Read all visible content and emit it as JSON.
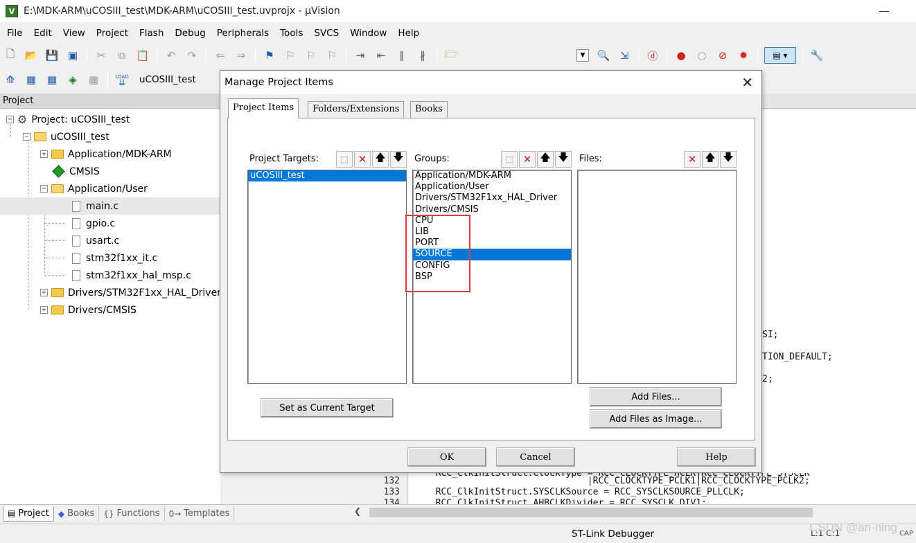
{
  "window": {
    "title": "E:\\MDK-ARM\\uCOSIII_test\\MDK-ARM\\uCOSIII_test.uvprojx - µVision",
    "icon_label": "V",
    "minimize": "—"
  },
  "menu": [
    "File",
    "Edit",
    "View",
    "Project",
    "Flash",
    "Debug",
    "Peripherals",
    "Tools",
    "SVCS",
    "Window",
    "Help"
  ],
  "toolbar": {
    "target_name": "uCOSIII_test",
    "load_label": "LOAD"
  },
  "project_panel": {
    "header": "Project",
    "root": "Project: uCOSIII_test",
    "target": "uCOSIII_test",
    "groups": [
      {
        "name": "Application/MDK-ARM",
        "expanded": false
      },
      {
        "name": "CMSIS",
        "kind": "component"
      },
      {
        "name": "Application/User",
        "expanded": true,
        "files": [
          "main.c",
          "gpio.c",
          "usart.c",
          "stm32f1xx_it.c",
          "stm32f1xx_hal_msp.c"
        ]
      },
      {
        "name": "Drivers/STM32F1xx_HAL_Driver",
        "expanded": false
      },
      {
        "name": "Drivers/CMSIS",
        "expanded": false
      }
    ],
    "selected_file": "main.c"
  },
  "bottom_tabs": [
    {
      "label": "Project",
      "active": true
    },
    {
      "label": "Books",
      "active": false
    },
    {
      "label": "Functions",
      "active": false,
      "glyph": "{}"
    },
    {
      "label": "Templates",
      "active": false,
      "glyph": "0→"
    }
  ],
  "editor": {
    "right_fragments": [
      "SI;",
      "TION_DEFAULT;",
      "2;"
    ],
    "lines": [
      {
        "num": "",
        "text": "  RCC_ClkInitStruct.ClockType = RCC_CLOCKTYPE_HCLK|RCC_CLOCKTYPE_SYSCLK"
      },
      {
        "num": "132",
        "text": "                              |RCC_CLOCKTYPE_PCLK1|RCC_CLOCKTYPE_PCLK2;"
      },
      {
        "num": "133",
        "text": "  RCC_ClkInitStruct.SYSCLKSource = RCC_SYSCLKSOURCE_PLLCLK;"
      },
      {
        "num": "134",
        "text": "  RCC_ClkInitStruct.AHBCLKDivider = RCC_SYSCLK_DIV1;"
      }
    ]
  },
  "status": {
    "debugger": "ST-Link Debugger",
    "position": "L:1 C:1",
    "caps": "CAP"
  },
  "watermark": "CSDN @an-ning",
  "dialog": {
    "title": "Manage Project Items",
    "close": "✕",
    "tabs": [
      "Project Items",
      "Folders/Extensions",
      "Books"
    ],
    "active_tab": "Project Items",
    "targets_label": "Project Targets:",
    "groups_label": "Groups:",
    "files_label": "Files:",
    "targets": [
      "uCOSIII_test"
    ],
    "selected_target": "uCOSIII_test",
    "groups": [
      "Application/MDK-ARM",
      "Application/User",
      "Drivers/STM32F1xx_HAL_Driver",
      "Drivers/CMSIS",
      "CPU",
      "LIB",
      "PORT",
      "SOURCE",
      "CONFIG",
      "BSP"
    ],
    "selected_group": "SOURCE",
    "files": [],
    "highlight_color": "#e03a3a",
    "buttons": {
      "set_current_target": "Set as Current Target",
      "add_files": "Add Files...",
      "add_files_as_image": "Add Files as Image...",
      "ok": "OK",
      "cancel": "Cancel",
      "help": "Help"
    }
  },
  "colors": {
    "selection": "#0078d7",
    "app_icon": "#3a7a2c"
  }
}
